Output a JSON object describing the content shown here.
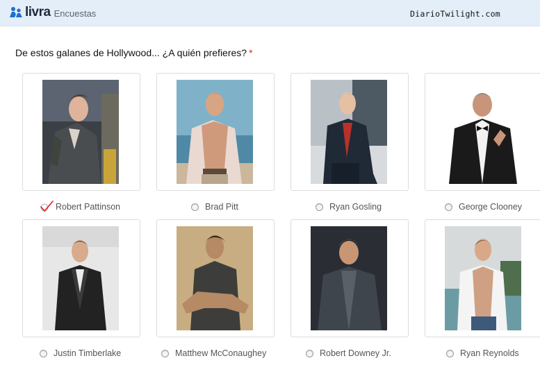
{
  "header": {
    "logo_text": "livra",
    "logo_subtitle": "Encuestas",
    "site_name": "DiarioTwilight.com"
  },
  "question": {
    "text": "De estos galanes de Hollywood... ¿A quién prefieres?",
    "required_mark": "*"
  },
  "options": [
    {
      "label": "Robert Pattinson",
      "selected": true
    },
    {
      "label": "Brad Pitt",
      "selected": false
    },
    {
      "label": "Ryan Gosling",
      "selected": false
    },
    {
      "label": "George Clooney",
      "selected": false
    },
    {
      "label": "Justin Timberlake",
      "selected": false
    },
    {
      "label": "Matthew McConaughey",
      "selected": false
    },
    {
      "label": "Robert Downey Jr.",
      "selected": false
    },
    {
      "label": "Ryan Reynolds",
      "selected": false
    }
  ],
  "colors": {
    "header_bg": "#e3eef9",
    "logo_blue": "#1f6fd1",
    "required_red": "#e02020",
    "check_red": "#d42020"
  }
}
